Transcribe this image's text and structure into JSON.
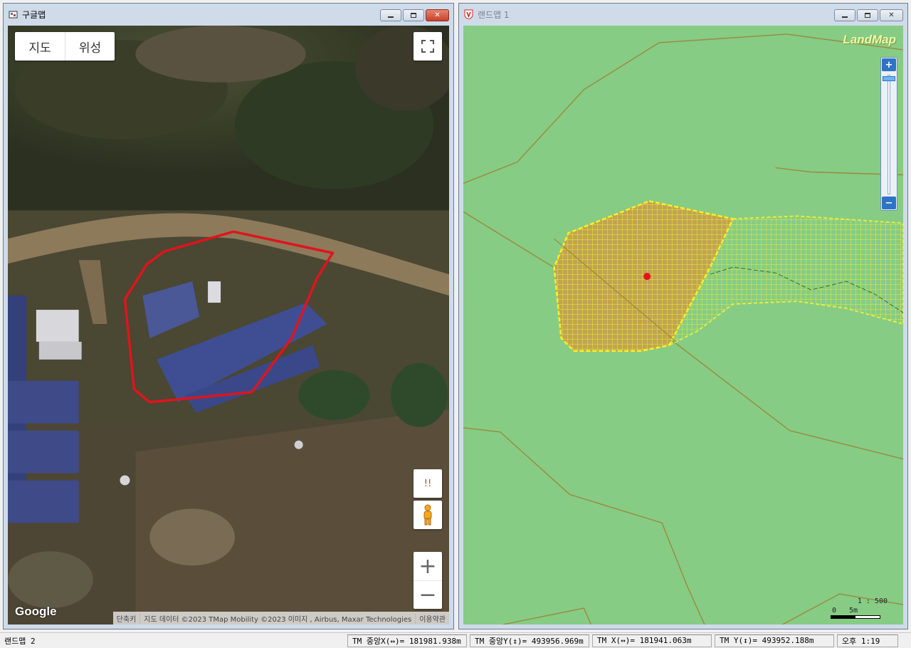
{
  "left_window": {
    "title": "구글맵",
    "icon": "map-window-icon",
    "buttons": {
      "minimize": "▭",
      "restore": "⧉",
      "close": "✕"
    },
    "map_type_tabs": [
      "지도",
      "위성"
    ],
    "street_view_alert": "!!",
    "zoom_in": "+",
    "zoom_out": "−",
    "google_logo": "Google",
    "attribution": [
      "단축키",
      "지도 데이터 ©2023 TMap Mobility ©2023 이미지 , Airbus, Maxar Technologies",
      "이용약관"
    ],
    "boundary_color": "#e0141c"
  },
  "right_window": {
    "title": "랜드맵 1",
    "icon": "v-shield-icon",
    "buttons": {
      "minimize": "▭",
      "restore": "⧉",
      "close": "✕"
    },
    "logo": "LandMap",
    "zoom_in": "+",
    "zoom_out": "−",
    "scale_ratio": "1 : 500",
    "scale_labels": [
      "0",
      "5m"
    ],
    "colors": {
      "background": "#86cc85",
      "parcel_fill": "#c9a04a",
      "hatch": "#e8ec3c",
      "parcel_line": "#9b8a3a",
      "center_point": "#e4141c"
    }
  },
  "status_bar": {
    "app_name": "랜드맵 2",
    "center_x": "TM 중앙X(↔)= 181981.938m",
    "center_y": "TM 중앙Y(↕)= 493956.969m",
    "tm_x": "TM X(↔)= 181941.063m",
    "tm_y": "TM Y(↕)= 493952.188m",
    "time": "오후 1:19"
  }
}
